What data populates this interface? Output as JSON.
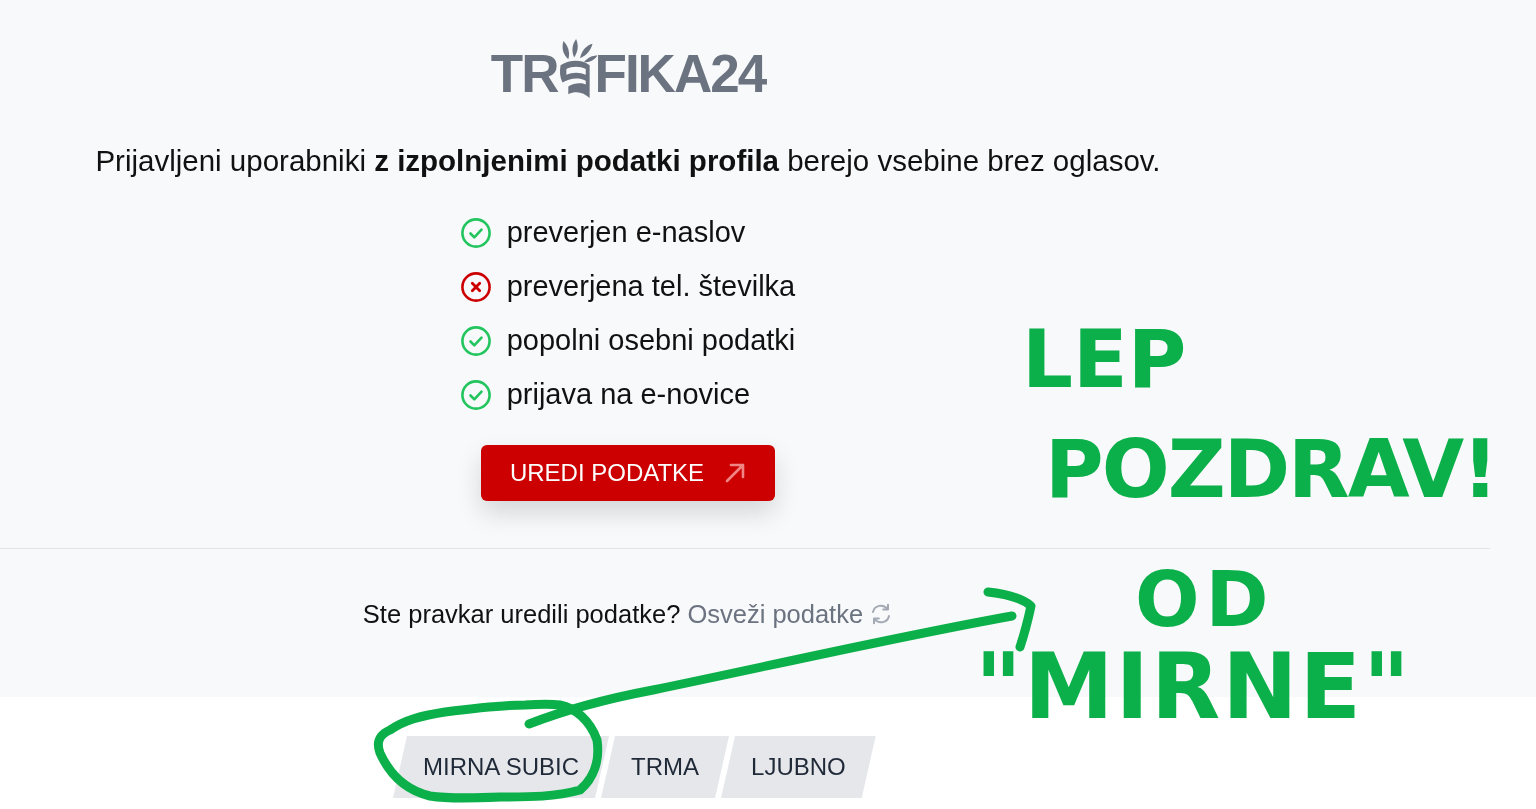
{
  "logo": {
    "text_before": "TR",
    "text_after": "FIKA24"
  },
  "intro": "Prijavljeni uporabniki **z izpolnjenimi podatki profila** berejo vsebine brez oglasov.",
  "requirements": [
    {
      "label": "preverjen e-naslov",
      "done": true
    },
    {
      "label": "preverjena tel. številka",
      "done": false
    },
    {
      "label": "popolni osebni podatki",
      "done": true
    },
    {
      "label": "prijava na e-novice",
      "done": true
    }
  ],
  "edit_button": {
    "label": "UREDI PODATKE"
  },
  "refresh": {
    "question": "Ste pravkar uredili podatke?",
    "link": "Osveži podatke"
  },
  "tabs": [
    {
      "label": "MIRNA SUBIC",
      "selected": false
    },
    {
      "label": "TRMA",
      "selected": false
    },
    {
      "label": "LJUBNO",
      "selected": false
    }
  ],
  "annotation": {
    "lines": [
      "LEP",
      "POZDRAV!",
      "OD",
      "\"MIRNE\""
    ]
  }
}
